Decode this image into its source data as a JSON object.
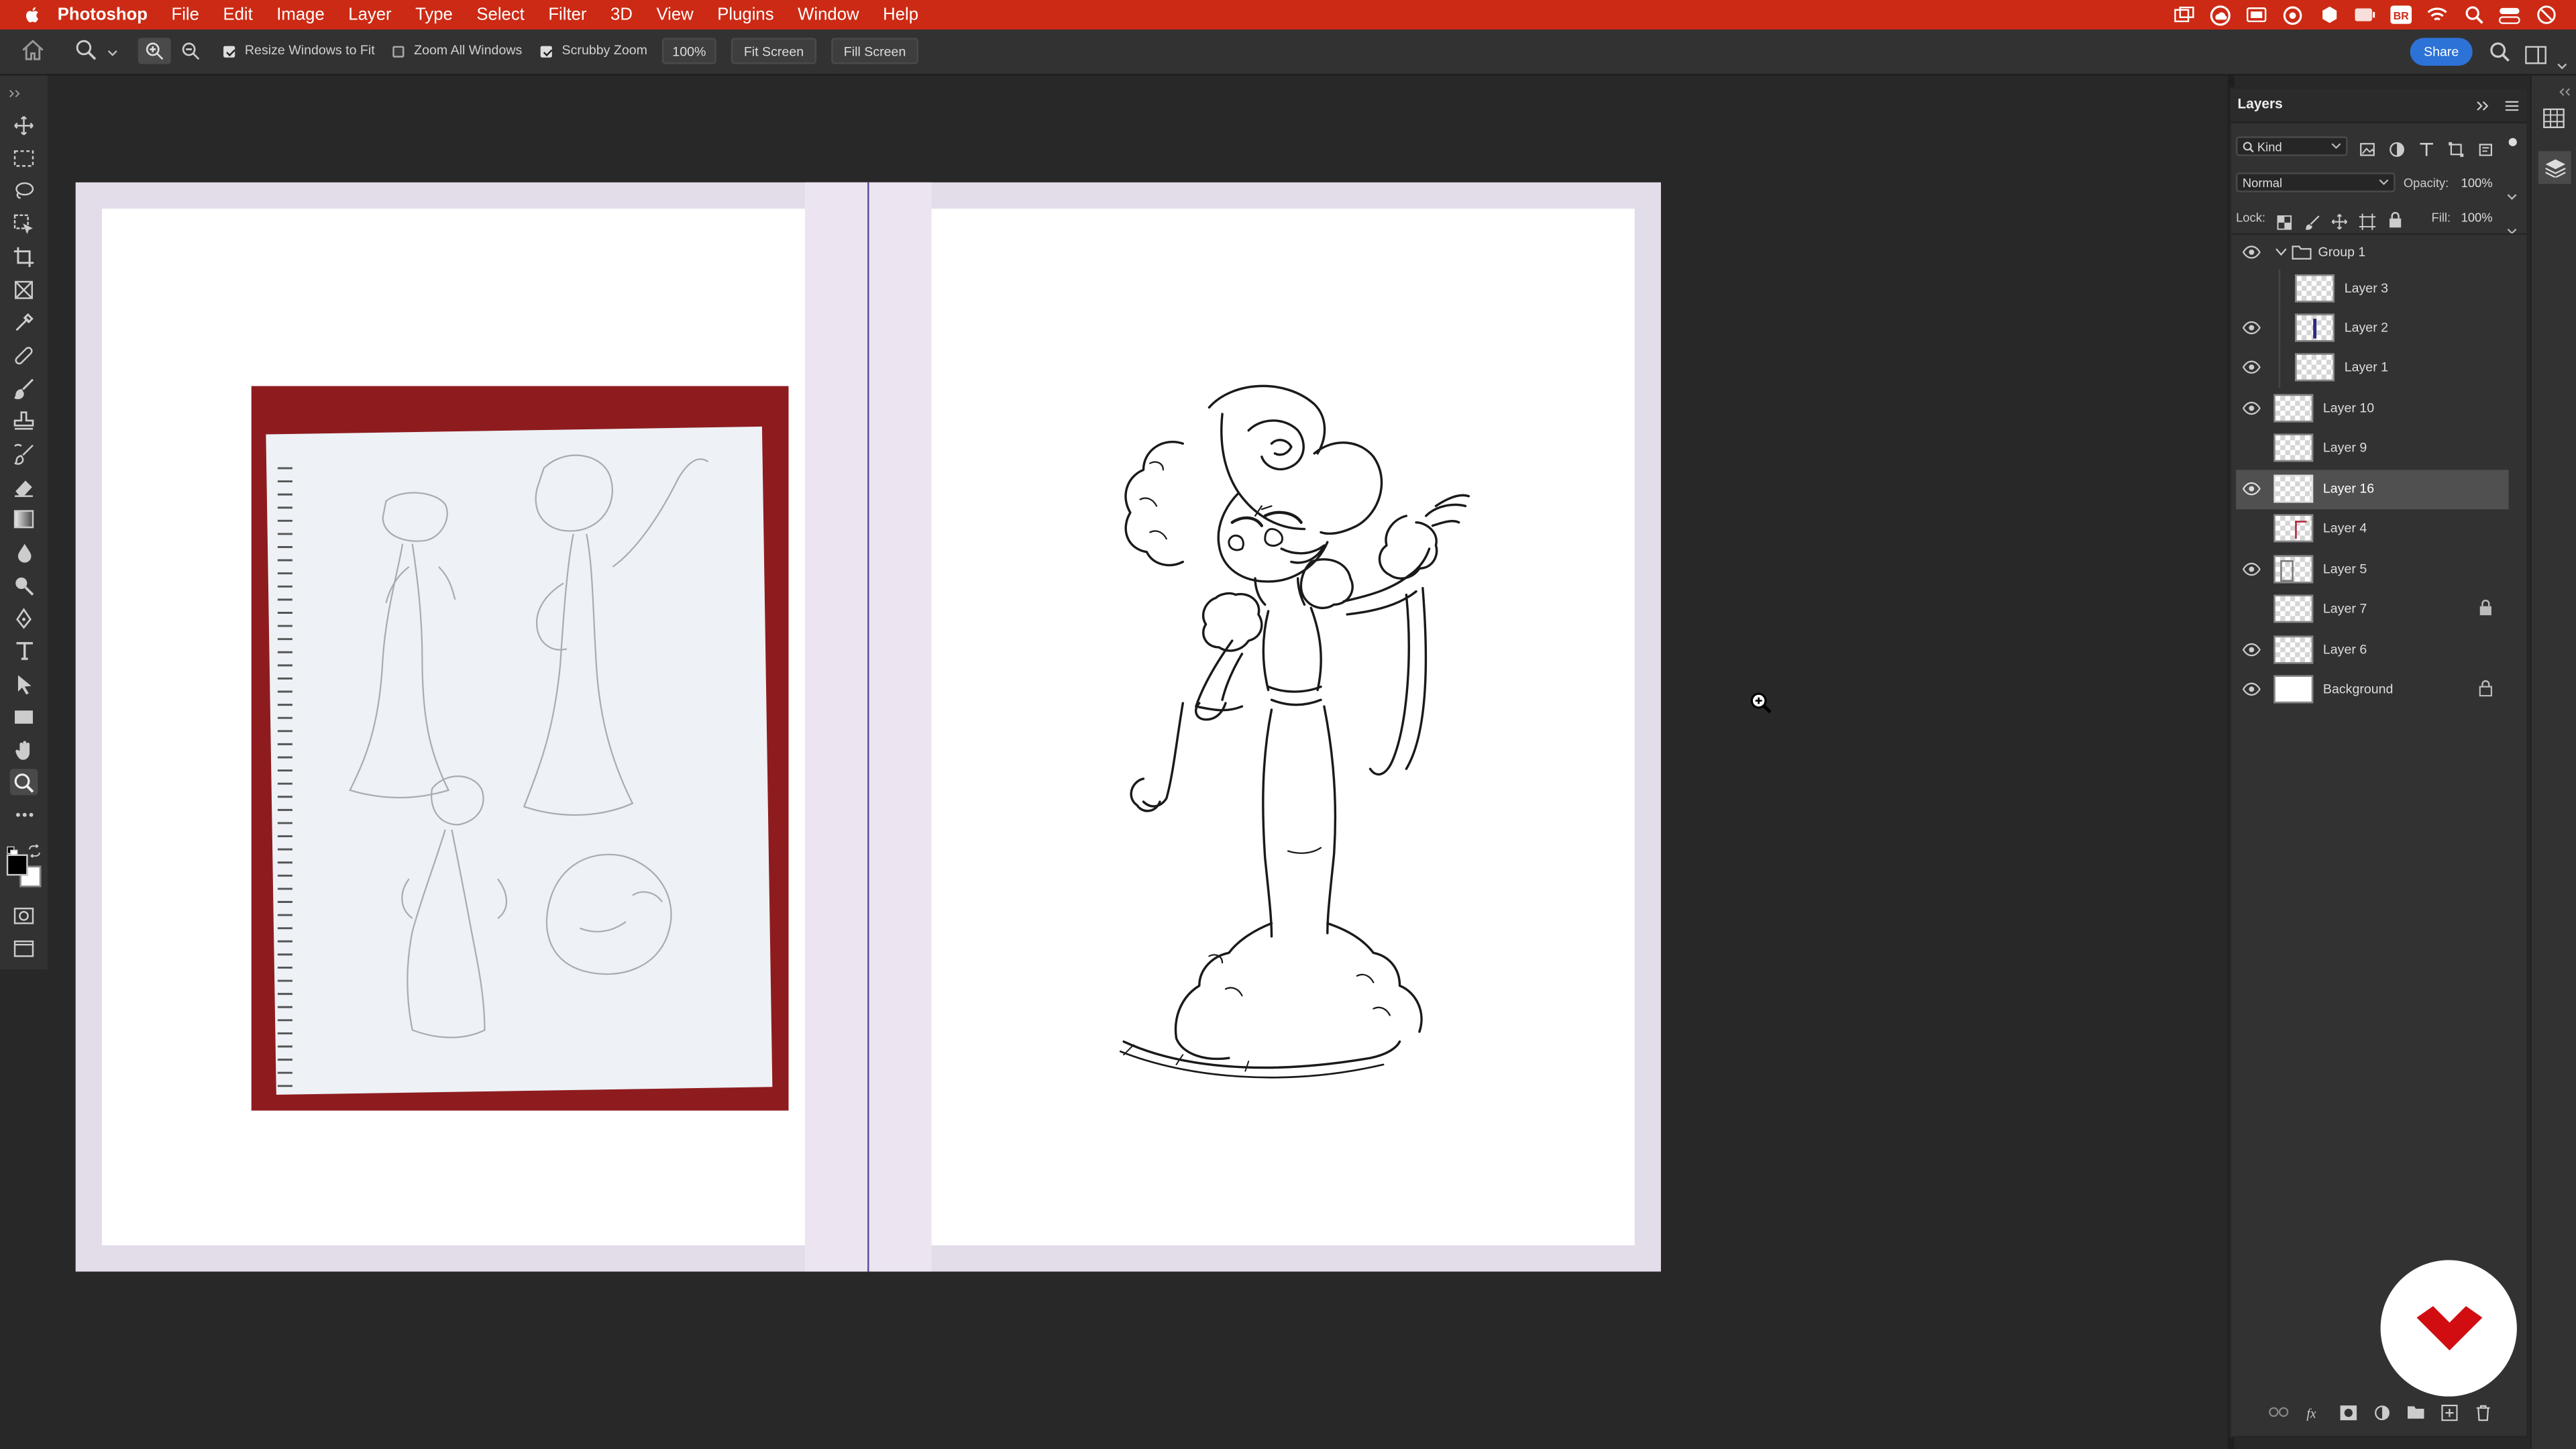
{
  "menubar": {
    "app_name": "Photoshop",
    "items": [
      "File",
      "Edit",
      "Image",
      "Layer",
      "Type",
      "Select",
      "Filter",
      "3D",
      "View",
      "Plugins",
      "Window",
      "Help"
    ],
    "status_icons": [
      "window-icon",
      "creative-cloud-icon",
      "screen-mirror-icon",
      "sync-icon",
      "notification-icon",
      "battery-icon",
      "user-badge-icon",
      "wifi-icon",
      "spotlight-icon",
      "control-center-icon",
      "clock-icon"
    ],
    "user_badge": "BR"
  },
  "options_bar": {
    "resize_windows_to_fit": {
      "label": "Resize Windows to Fit",
      "checked": true
    },
    "zoom_all_windows": {
      "label": "Zoom All Windows",
      "checked": false
    },
    "scrubby_zoom": {
      "label": "Scrubby Zoom",
      "checked": true
    },
    "zoom_value": "100%",
    "fit_screen": "Fit Screen",
    "fill_screen": "Fill Screen",
    "share": "Share"
  },
  "toolbar": {
    "tools": [
      "move-icon",
      "marquee-icon",
      "lasso-icon",
      "object-select-icon",
      "crop-icon",
      "frame-icon",
      "eyedropper-icon",
      "healing-icon",
      "brush-icon",
      "stamp-icon",
      "history-brush-icon",
      "eraser-icon",
      "gradient-icon",
      "blur-icon",
      "dodge-icon",
      "pen-icon",
      "type-icon",
      "path-select-icon",
      "rectangle-icon",
      "hand-icon",
      "zoom-icon",
      "more-tools-icon"
    ],
    "active_tool": "zoom-icon",
    "foreground_color": "#000000",
    "background_color": "#ffffff"
  },
  "layers_panel": {
    "title": "Layers",
    "filter_kind": "Kind",
    "blend_mode": "Normal",
    "opacity_label": "Opacity:",
    "opacity": "100%",
    "lock_label": "Lock:",
    "fill_label": "Fill:",
    "fill": "100%",
    "layers": [
      {
        "name": "Group 1",
        "visible": true,
        "is_group": true,
        "indent": 0
      },
      {
        "name": "Layer 3",
        "visible": false,
        "indent": 1
      },
      {
        "name": "Layer 2",
        "visible": true,
        "indent": 1
      },
      {
        "name": "Layer 1",
        "visible": true,
        "indent": 1
      },
      {
        "name": "Layer 10",
        "visible": true,
        "indent": 0
      },
      {
        "name": "Layer 9",
        "visible": false,
        "indent": 0
      },
      {
        "name": "Layer 16",
        "visible": true,
        "indent": 0,
        "selected": true
      },
      {
        "name": "Layer 4",
        "visible": false,
        "indent": 0
      },
      {
        "name": "Layer 5",
        "visible": true,
        "indent": 0
      },
      {
        "name": "Layer 7",
        "visible": false,
        "indent": 0,
        "locked": true
      },
      {
        "name": "Layer 6",
        "visible": true,
        "indent": 0
      },
      {
        "name": "Background",
        "visible": true,
        "indent": 0,
        "locked": true,
        "plain": true
      }
    ]
  },
  "colors": {
    "menubar": "#cc2a14",
    "panel": "#323232",
    "canvas_bg": "#282828",
    "artboard": "#e3dce9",
    "photo_backdrop": "#8e1c1f",
    "accent": "#2d72d6",
    "brand": "#d10d12"
  }
}
